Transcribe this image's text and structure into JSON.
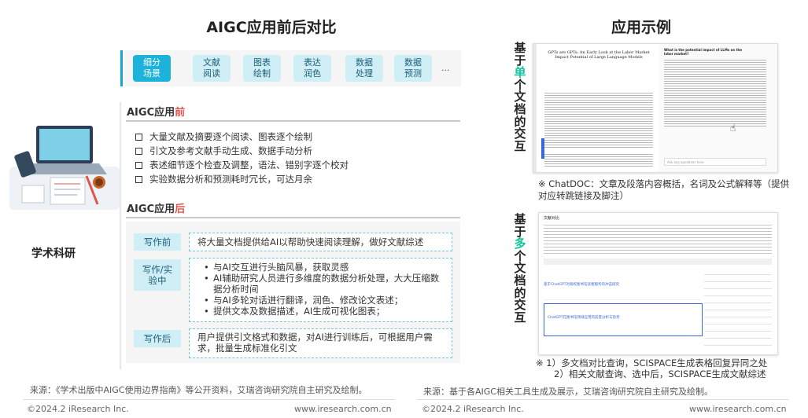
{
  "left": {
    "title": "AIGC应用前后对比",
    "categories": [
      "细分场景",
      "文献阅读",
      "图表绘制",
      "表达润色",
      "数据处理",
      "数据预测",
      "..."
    ],
    "subject": "学术科研",
    "before": {
      "heading_prefix": "AIGC应用",
      "heading_highlight": "前",
      "items": [
        "大量文献及摘要逐个阅读、图表逐个绘制",
        "引文及参考文献手动生成、数据手动分析",
        "表述细节逐个检查及调整，语法、错别字逐个校对",
        "实验数据分析和预测耗时冗长，可达月余"
      ]
    },
    "after": {
      "heading_prefix": "AIGC应用",
      "heading_highlight": "后",
      "rows": [
        {
          "tag": "写作前",
          "text": "将大量文档提供给AI以帮助快速阅读理解，做好文献综述"
        },
        {
          "tag": "写作/实验中",
          "items": [
            "与AI交互进行头脑风暴，获取灵感",
            "AI辅助研究人员进行多维度的数据分析处理，大大压缩数据分析时间",
            "与AI多轮对话进行翻译，润色、修改论文表述；",
            "提供文本及数据描述，AI生成可视化图表；"
          ]
        },
        {
          "tag": "写作后",
          "text": "用户提供引文格式和数据，对AI进行训练后，可根据用户需求，批量生成标准化引文"
        }
      ]
    },
    "source": "来源：《学术出版中AIGC使用边界指南》等公开资料，艾瑞咨询研究院自主研究及绘制。",
    "copyright": "©2024.2 iResearch Inc.",
    "website": "www.iresearch.com.cn"
  },
  "right": {
    "title": "应用示例",
    "single": {
      "chars": [
        "基",
        "于",
        "单",
        "个",
        "文",
        "档",
        "的",
        "交",
        "互"
      ],
      "highlight_index": 2,
      "note": "※  ChatDOC：文章及段落内容概括，名词及公式解释等（提供对应转跳链接及脚注）",
      "mock": {
        "paper_title": "GPTs are GPTs: An Early Look at the Labor Market Impact Potential of Large Language Models",
        "question": "What is the potential impact of LLMs on the labor market?",
        "answer_sample": "According to the study, Generative Pretrained Transformers (GPTs) and related technology, also known as Large Language Models (LLMs), have the potential to impact approximately 80% of the US workforce...",
        "input_placeholder": "Ask any questions here"
      }
    },
    "multi": {
      "chars": [
        "基",
        "于",
        "多",
        "个",
        "文",
        "档",
        "的",
        "交",
        "互"
      ],
      "highlight_index": 2,
      "note_lines": [
        "※   1）多文档对比查询，SCISPACE生成表格回复异同之处",
        "2）相关文献查询、选中后，SCISPACE生成文献综述"
      ],
      "mock": {
        "header": "文献对比",
        "row1": "基于ChatGPT对高校图书馆读者服务的冲击研究",
        "row2": "ChatGPT在图书馆领域应用的前景分析与思考"
      }
    },
    "source": "来源：基于各AIGC相关工具生成及展示，艾瑞咨询研究院自主研究及绘制。",
    "copyright": "©2024.2 iResearch Inc.",
    "website": "www.iresearch.com.cn"
  },
  "colors": {
    "accent": "#1db2d9",
    "chip": "#cfeef5",
    "highlight_red": "#e0564f",
    "highlight_green": "#13c3a0"
  }
}
